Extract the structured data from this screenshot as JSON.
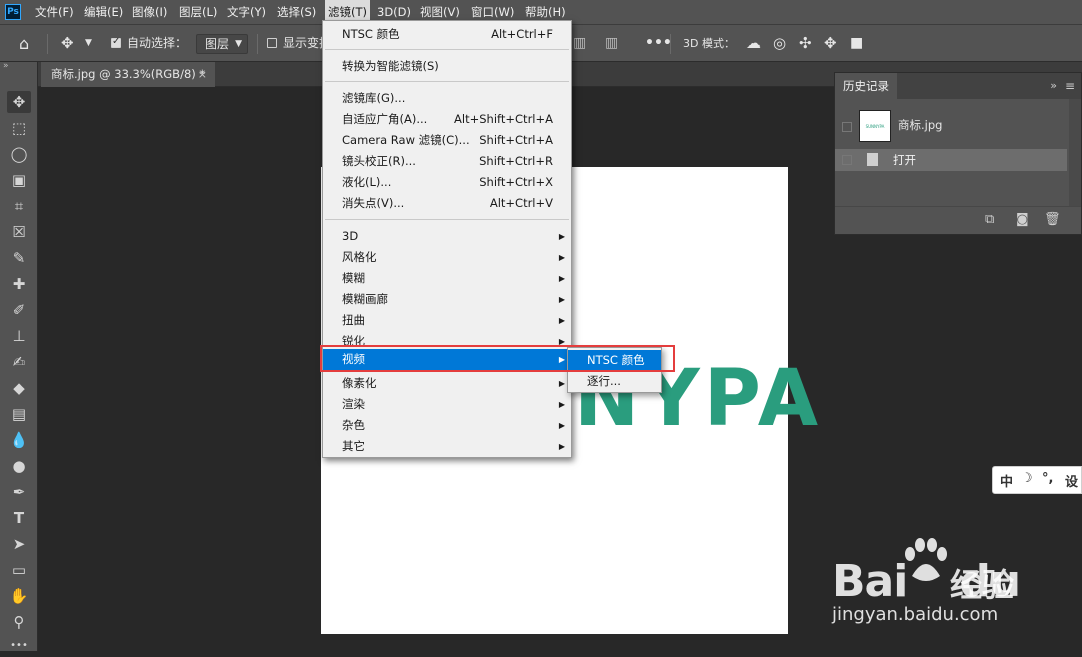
{
  "app": {
    "logo_text": "Ps"
  },
  "menubar": {
    "items": [
      "文件(F)",
      "编辑(E)",
      "图像(I)",
      "图层(L)",
      "文字(Y)",
      "选择(S)",
      "滤镜(T)",
      "3D(D)",
      "视图(V)",
      "窗口(W)",
      "帮助(H)"
    ],
    "active": "滤镜(T)"
  },
  "options_bar": {
    "auto_select_label": "自动选择：",
    "auto_select_checked": true,
    "layer_select_value": "图层",
    "show_transform_label": "显示变换",
    "show_transform_checked": false,
    "more_label": "•••",
    "mode_3d_label": "3D 模式："
  },
  "document": {
    "tab_title": "商标.jpg @ 33.3%(RGB/8) *",
    "close_glyph": "×",
    "canvas_logo_text": "NYPA"
  },
  "history_panel": {
    "title": "历史记录",
    "collapse_glyph": "»",
    "snapshot_label": "商标.jpg",
    "snapshot_thumb_text": "SUNNYPA",
    "state_label": "打开"
  },
  "filter_menu": {
    "groups": [
      [
        {
          "label": "NTSC 颜色",
          "shortcut": "Alt+Ctrl+F"
        }
      ],
      [
        {
          "label": "转换为智能滤镜(S)",
          "shortcut": ""
        }
      ],
      [
        {
          "label": "滤镜库(G)...",
          "shortcut": ""
        },
        {
          "label": "自适应广角(A)...",
          "shortcut": "Alt+Shift+Ctrl+A"
        },
        {
          "label": "Camera Raw 滤镜(C)...",
          "shortcut": "Shift+Ctrl+A"
        },
        {
          "label": "镜头校正(R)...",
          "shortcut": "Shift+Ctrl+R"
        },
        {
          "label": "液化(L)...",
          "shortcut": "Shift+Ctrl+X"
        },
        {
          "label": "消失点(V)...",
          "shortcut": "Alt+Ctrl+V"
        }
      ],
      [
        {
          "label": "3D",
          "submenu": true
        },
        {
          "label": "风格化",
          "submenu": true
        },
        {
          "label": "模糊",
          "submenu": true
        },
        {
          "label": "模糊画廊",
          "submenu": true
        },
        {
          "label": "扭曲",
          "submenu": true
        },
        {
          "label": "锐化",
          "submenu": true
        },
        {
          "label": "视频",
          "submenu": true,
          "highlighted": true
        },
        {
          "label": "像素化",
          "submenu": true
        },
        {
          "label": "渲染",
          "submenu": true
        },
        {
          "label": "杂色",
          "submenu": true
        },
        {
          "label": "其它",
          "submenu": true
        }
      ]
    ]
  },
  "video_submenu": {
    "items": [
      {
        "label": "NTSC 颜色",
        "highlighted": true
      },
      {
        "label": "逐行...",
        "highlighted": false
      }
    ]
  },
  "ime_toolbar": {
    "items": [
      "中",
      "☽",
      "°,",
      "设"
    ]
  },
  "watermark": {
    "brand": "Bai",
    "brand_suffix": "du",
    "cn": "经验",
    "url": "jingyan.baidu.com"
  },
  "colors": {
    "highlight": "#0078d7",
    "annotation": "#e43d3d",
    "logo_green": "#2a9d7e"
  }
}
